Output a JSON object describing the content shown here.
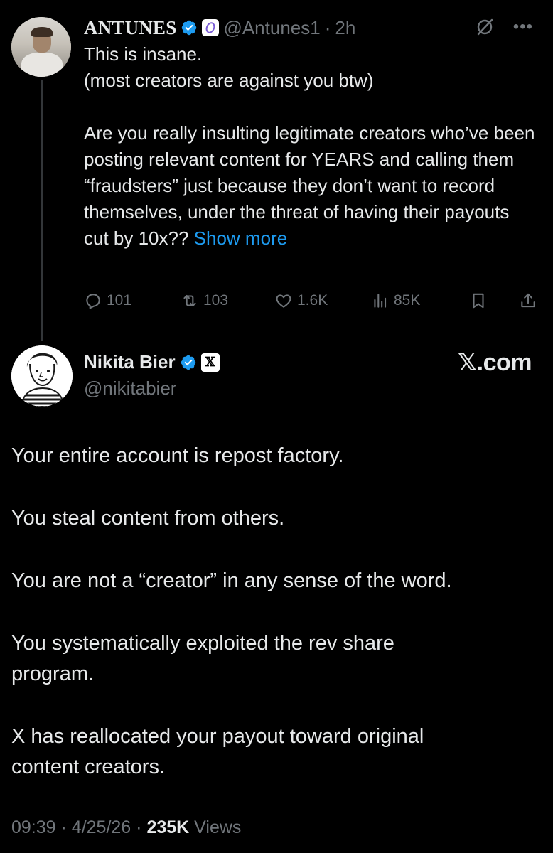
{
  "tweet_reply": {
    "author_name": "ANTUNES",
    "affiliate_badge": "purple-flower-badge",
    "handle": "@Antunes1",
    "separator": "·",
    "time": "2h",
    "body_lines": [
      "This is insane.",
      "(most creators are against you btw)"
    ],
    "body_para2": "Are you really insulting legitimate creators who’ve been posting relevant content for YEARS and calling them “fraudsters” just because they don’t want to record themselves, under the threat of having their payouts cut by 10x??",
    "show_more": "Show more",
    "stats": {
      "replies": "101",
      "reposts": "103",
      "likes": "1.6K",
      "views": "85K"
    }
  },
  "tweet_main": {
    "author_name": "Nikita Bier",
    "affiliate_badge": "𝕏",
    "handle": "@nikitabier",
    "brand": "𝕏.com",
    "paragraphs": [
      "Your entire account is repost factory.",
      "You steal content from others.",
      "You are not a “creator” in any sense of the word.",
      "You systematically exploited the rev share program.",
      "X has reallocated your payout toward original content creators."
    ],
    "time": "09:39",
    "date": "4/25/26",
    "separator": "·",
    "views_count": "235K",
    "views_label": "Views"
  },
  "colors": {
    "background": "#000000",
    "text": "#e7e9ea",
    "muted": "#71767b",
    "link": "#1d9bf0",
    "verified": "#1d9bf0"
  }
}
